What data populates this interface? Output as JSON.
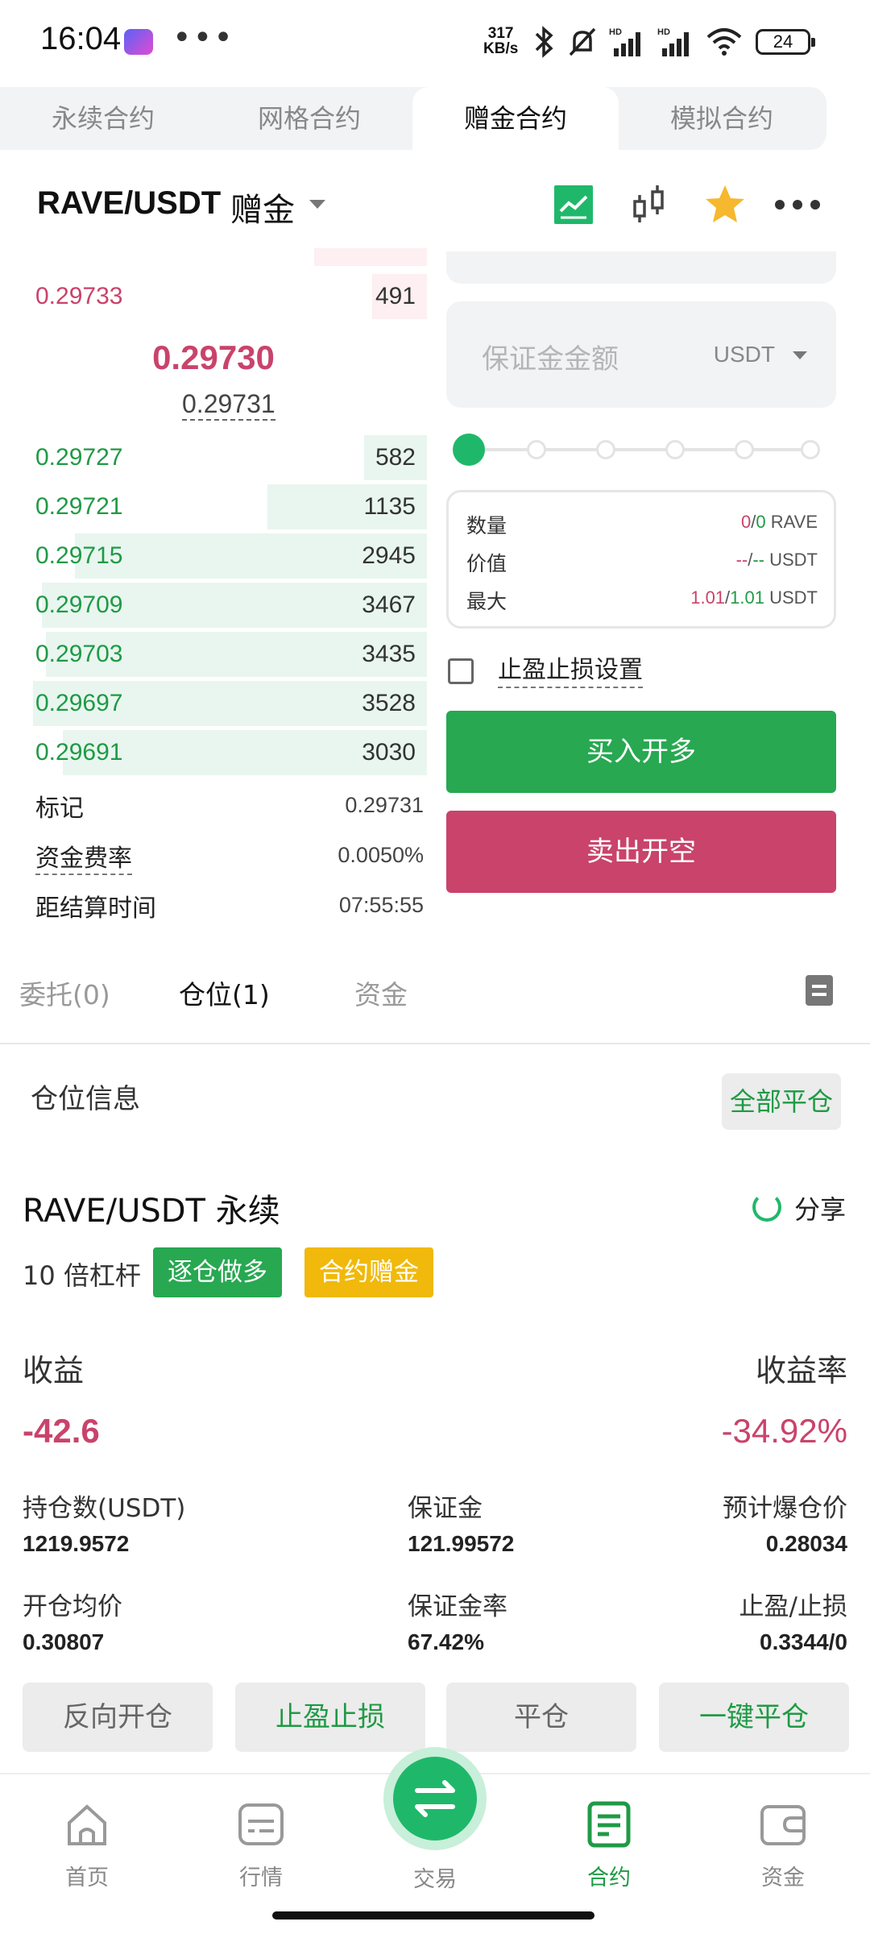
{
  "status_bar": {
    "time": "16:04",
    "dots": "•••",
    "net_speed_top": "317",
    "net_speed_bottom": "KB/s",
    "battery": "24"
  },
  "contract_tabs": [
    "永续合约",
    "网格合约",
    "赠金合约",
    "模拟合约"
  ],
  "pair": {
    "name": "RAVE/USDT",
    "tag": "赠金"
  },
  "order_book": {
    "asks": [
      {
        "price": "0.29733",
        "qty": "491",
        "depth": 0.13
      }
    ],
    "mid_price": "0.29730",
    "mark_price": "0.29731",
    "bids": [
      {
        "price": "0.29727",
        "qty": "582",
        "depth": 0.15
      },
      {
        "price": "0.29721",
        "qty": "1135",
        "depth": 0.38
      },
      {
        "price": "0.29715",
        "qty": "2945",
        "depth": 0.84
      },
      {
        "price": "0.29709",
        "qty": "3467",
        "depth": 0.92
      },
      {
        "price": "0.29703",
        "qty": "3435",
        "depth": 0.91
      },
      {
        "price": "0.29697",
        "qty": "3528",
        "depth": 0.94
      },
      {
        "price": "0.29691",
        "qty": "3030",
        "depth": 0.87
      }
    ],
    "mark_label": "标记",
    "mark_value": "0.29731",
    "funding_label": "资金费率",
    "funding_value": "0.0050%",
    "settle_label": "距结算时间",
    "settle_value": "07:55:55"
  },
  "order_form": {
    "margin_placeholder": "保证金金额",
    "margin_unit": "USDT",
    "leverage_slider": 0,
    "qty_label": "数量",
    "qty_a": "0",
    "qty_sep": "/",
    "qty_b": "0",
    "qty_unit": " RAVE",
    "value_label": "价值",
    "value_a": "--",
    "value_sep": "/",
    "value_b": "--",
    "value_unit": " USDT",
    "max_label": "最大",
    "max_a": "1.01",
    "max_sep": "/",
    "max_b": "1.01",
    "max_unit": " USDT",
    "tpsl_label": "止盈止损设置",
    "buy_label": "买入开多",
    "sell_label": "卖出开空"
  },
  "sub_tabs": [
    "委托(0)",
    "仓位(1)",
    "资金"
  ],
  "position": {
    "section_title": "仓位信息",
    "close_all_label": "全部平仓",
    "symbol": "RAVE/USDT 永续",
    "share_label": "分享",
    "leverage": "10 倍杠杆",
    "badge_mode": "逐仓做多",
    "badge_bonus": "合约赠金",
    "pnl_label": "收益",
    "pnl_value": "-42.6",
    "roi_label": "收益率",
    "roi_value": "-34.92%",
    "size_label": "持仓数(USDT)",
    "size_value": "1219.9572",
    "margin_label": "保证金",
    "margin_value": "121.99572",
    "liq_label": "预计爆仓价",
    "liq_value": "0.28034",
    "entry_label": "开仓均价",
    "entry_value": "0.30807",
    "margin_ratio_label": "保证金率",
    "margin_ratio_value": "67.42%",
    "tpsl_label": "止盈/止损",
    "tpsl_value": "0.3344/0",
    "buttons": [
      "反向开仓",
      "止盈止损",
      "平仓",
      "一键平仓"
    ]
  },
  "bottom_nav": [
    "首页",
    "行情",
    "交易",
    "合约",
    "资金"
  ],
  "colors": {
    "green": "#27a851",
    "red": "#c9436b",
    "gold": "#f0b90b"
  }
}
